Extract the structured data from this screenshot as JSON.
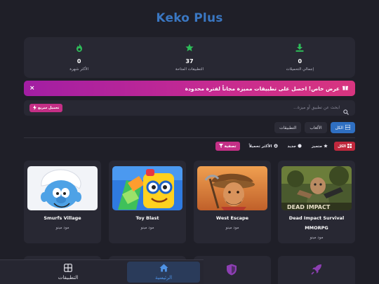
{
  "app": {
    "title": "Keko Plus"
  },
  "stats": [
    {
      "value": "0",
      "label": "الأكثر شهرة",
      "icon": "flame-icon",
      "color": "#2ebd59"
    },
    {
      "value": "37",
      "label": "التطبيقات المتاحة",
      "icon": "star-icon",
      "color": "#2ebd59"
    },
    {
      "value": "0",
      "label": "إجمالي التحميلات",
      "icon": "download-icon",
      "color": "#2ebd59"
    }
  ],
  "promo": {
    "text": "عرض خاص! احصل على تطبيقات مميزة مجاناً لفترة محدودة",
    "icon": "gift-icon",
    "close": "×"
  },
  "search": {
    "placeholder": "ابحث عن تطبيق أو ميزة...",
    "fast_label": "تحميل سريع"
  },
  "tabs": [
    {
      "label": "الكل",
      "active": true
    },
    {
      "label": "الألعاب",
      "active": false
    },
    {
      "label": "التطبيقات",
      "active": false
    }
  ],
  "filters": [
    {
      "label": "الكل",
      "style": "all"
    },
    {
      "label": "متميز",
      "style": "plain"
    },
    {
      "label": "جديد",
      "style": "plain"
    },
    {
      "label": "الأكثر تحميلاً",
      "style": "plain"
    }
  ],
  "sort_label": "تصفية",
  "cards": [
    {
      "name": "Smurfs Village",
      "name2": "",
      "sub": "مود مينو"
    },
    {
      "name": "Toy Blast",
      "name2": "",
      "sub": "مود مينو"
    },
    {
      "name": "West Escape",
      "name2": "",
      "sub": "مود مينو"
    },
    {
      "name": "Dead Impact Survival",
      "name2": "MMORPG",
      "sub": "مود مينو"
    }
  ],
  "nav": {
    "apps_label": "التطبيقات",
    "home_label": "الرئيسية"
  },
  "colors": {
    "accent": "#2f6fc1",
    "pink": "#c42f86",
    "green": "#2ebd59"
  }
}
